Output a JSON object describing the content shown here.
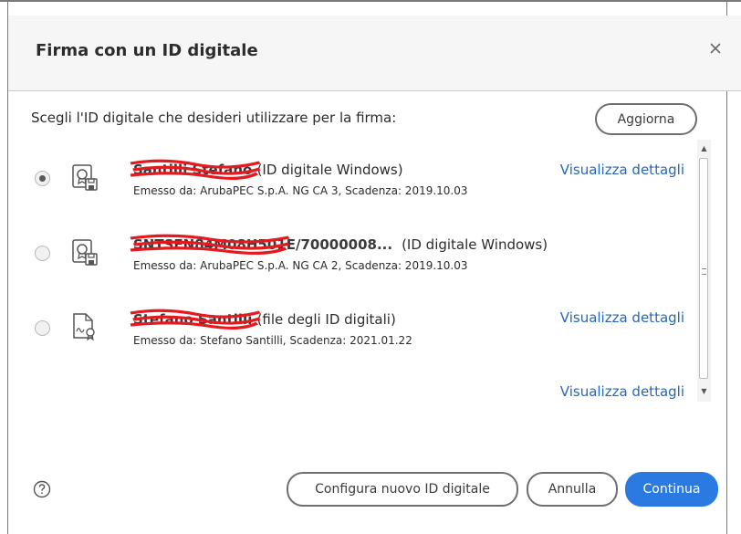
{
  "dialog": {
    "title": "Firma con un ID digitale",
    "prompt": "Scegli l'ID digitale che desideri utilizzare per la firma:",
    "refresh_label": "Aggiorna"
  },
  "ids": [
    {
      "name": "Santilli Stefano",
      "type": "(ID digitale Windows)",
      "issuer": "Emesso da: ArubaPEC S.p.A. NG CA 3, Scadenza: 2019.10.03",
      "details_label": "Visualizza dettagli",
      "selected": true,
      "icon": "certificate-icon"
    },
    {
      "name": "SNTSFN84M08H501E/70000008...",
      "type": "(ID digitale Windows)",
      "issuer": "Emesso da: ArubaPEC S.p.A. NG CA 2, Scadenza: 2019.10.03",
      "details_label": "",
      "selected": false,
      "icon": "certificate-icon"
    },
    {
      "name": "Stefano Santilli",
      "type": "(file degli ID digitali)",
      "issuer": "Emesso da: Stefano Santilli, Scadenza: 2021.01.22",
      "details_label": "Visualizza dettagli",
      "selected": false,
      "icon": "signed-document-icon"
    }
  ],
  "extra_link": "Visualizza dettagli",
  "footer": {
    "configure_label": "Configura nuovo ID digitale",
    "cancel_label": "Annulla",
    "continue_label": "Continua",
    "help_icon": "help-icon"
  },
  "colors": {
    "accent": "#2a7ae2",
    "link": "#2766b8",
    "redaction": "#e8191e"
  }
}
